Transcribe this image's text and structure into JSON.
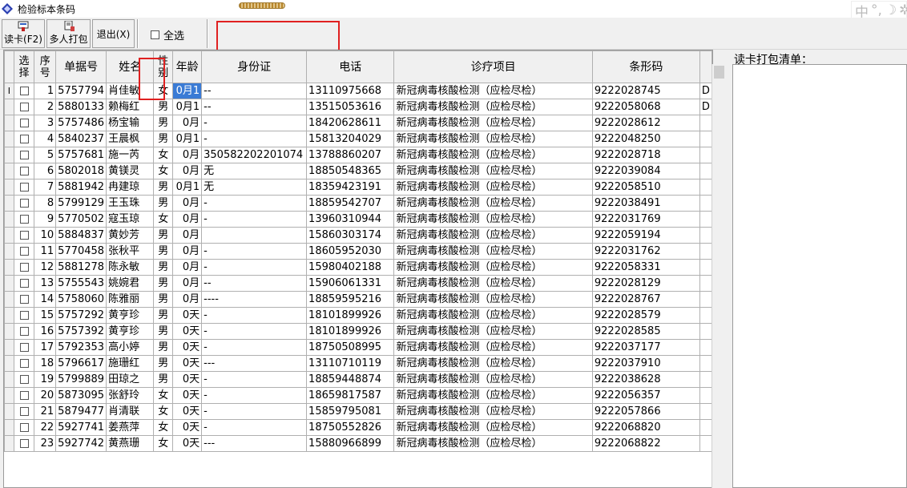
{
  "window": {
    "title": "检验标本条码"
  },
  "ime": {
    "label": "中"
  },
  "toolbar": {
    "read_card_label": "读卡(F2)",
    "multi_pack_label": "多人打包",
    "exit_label": "退出(X)",
    "select_all_label": "全选"
  },
  "table": {
    "headers": {
      "select": "选择",
      "seq": "序号",
      "doc_no": "单据号",
      "name": "姓名",
      "sex": "性别",
      "age": "年龄",
      "id_card": "身份证",
      "phone": "电话",
      "item": "诊疗项目",
      "barcode": "条形码"
    },
    "current_row_marker": "I",
    "rows": [
      {
        "seq": "1",
        "doc": "5757794",
        "name": "肖佳敏",
        "sex": "女",
        "age": "0月1",
        "id": "--",
        "phone": "13110975668",
        "item": "新冠病毒核酸检测（应检尽检）",
        "barcode": "9222028745",
        "extra": "D"
      },
      {
        "seq": "2",
        "doc": "5880133",
        "name": "赖梅红",
        "sex": "男",
        "age": "0月1",
        "id": "--",
        "phone": "13515053616",
        "item": "新冠病毒核酸检测（应检尽检）",
        "barcode": "9222058068",
        "extra": "D"
      },
      {
        "seq": "3",
        "doc": "5757486",
        "name": "杨宝输",
        "sex": "男",
        "age": "0月",
        "id": "-",
        "phone": "18420628611",
        "item": "新冠病毒核酸检测（应检尽检）",
        "barcode": "9222028612",
        "extra": ""
      },
      {
        "seq": "4",
        "doc": "5840237",
        "name": "王晨枫",
        "sex": "男",
        "age": "0月1",
        "id": "-",
        "phone": "15813204029",
        "item": "新冠病毒核酸检测（应检尽检）",
        "barcode": "9222048250",
        "extra": ""
      },
      {
        "seq": "5",
        "doc": "5757681",
        "name": "施一芮",
        "sex": "女",
        "age": "0月",
        "id": "350582202201074",
        "phone": "13788860207",
        "item": "新冠病毒核酸检测（应检尽检）",
        "barcode": "9222028718",
        "extra": ""
      },
      {
        "seq": "6",
        "doc": "5802018",
        "name": "黄镁灵",
        "sex": "女",
        "age": "0月",
        "id": "无",
        "phone": "18850548365",
        "item": "新冠病毒核酸检测（应检尽检）",
        "barcode": "9222039084",
        "extra": ""
      },
      {
        "seq": "7",
        "doc": "5881942",
        "name": "冉建琼",
        "sex": "男",
        "age": "0月1",
        "id": " 无",
        "phone": "18359423191",
        "item": "新冠病毒核酸检测（应检尽检）",
        "barcode": "9222058510",
        "extra": ""
      },
      {
        "seq": "8",
        "doc": "5799129",
        "name": "王玉珠",
        "sex": "男",
        "age": "0月",
        "id": "-",
        "phone": "18859542707",
        "item": "新冠病毒核酸检测（应检尽检）",
        "barcode": "9222038491",
        "extra": ""
      },
      {
        "seq": "9",
        "doc": "5770502",
        "name": "寇玉琼",
        "sex": "女",
        "age": "0月",
        "id": "-",
        "phone": "13960310944",
        "item": "新冠病毒核酸检测（应检尽检）",
        "barcode": "9222031769",
        "extra": ""
      },
      {
        "seq": "10",
        "doc": "5884837",
        "name": "黄妙芳",
        "sex": "男",
        "age": "0月",
        "id": "",
        "phone": "15860303174",
        "item": "新冠病毒核酸检测（应检尽检）",
        "barcode": "9222059194",
        "extra": ""
      },
      {
        "seq": "11",
        "doc": "5770458",
        "name": "张秋平",
        "sex": "男",
        "age": "0月",
        "id": "-",
        "phone": "18605952030",
        "item": "新冠病毒核酸检测（应检尽检）",
        "barcode": "9222031762",
        "extra": ""
      },
      {
        "seq": "12",
        "doc": "5881278",
        "name": "陈永敏",
        "sex": "男",
        "age": "0月",
        "id": "-",
        "phone": "15980402188",
        "item": "新冠病毒核酸检测（应检尽检）",
        "barcode": "9222058331",
        "extra": ""
      },
      {
        "seq": "13",
        "doc": "5755543",
        "name": "姚婉君",
        "sex": "男",
        "age": "0月",
        "id": "--",
        "phone": "15906061331",
        "item": "新冠病毒核酸检测（应检尽检）",
        "barcode": "9222028129",
        "extra": ""
      },
      {
        "seq": "14",
        "doc": "5758060",
        "name": "陈雅丽",
        "sex": "男",
        "age": "0月",
        "id": "----",
        "phone": "18859595216",
        "item": "新冠病毒核酸检测（应检尽检）",
        "barcode": "9222028767",
        "extra": ""
      },
      {
        "seq": "15",
        "doc": "5757292",
        "name": "黄亨珍",
        "sex": "男",
        "age": "0天",
        "id": "-",
        "phone": "18101899926",
        "item": "新冠病毒核酸检测（应检尽检）",
        "barcode": "9222028579",
        "extra": ""
      },
      {
        "seq": "16",
        "doc": "5757392",
        "name": "黄亨珍",
        "sex": "男",
        "age": "0天",
        "id": "-",
        "phone": "18101899926",
        "item": "新冠病毒核酸检测（应检尽检）",
        "barcode": "9222028585",
        "extra": ""
      },
      {
        "seq": "17",
        "doc": "5792353",
        "name": "高小婷",
        "sex": "男",
        "age": "0天",
        "id": "-",
        "phone": "18750508995",
        "item": "新冠病毒核酸检测（应检尽检）",
        "barcode": "9222037177",
        "extra": ""
      },
      {
        "seq": "18",
        "doc": "5796617",
        "name": "施珊红",
        "sex": "男",
        "age": "0天",
        "id": "---",
        "phone": "13110710119",
        "item": "新冠病毒核酸检测（应检尽检）",
        "barcode": "9222037910",
        "extra": ""
      },
      {
        "seq": "19",
        "doc": "5799889",
        "name": "田琼之",
        "sex": "男",
        "age": "0天",
        "id": "-",
        "phone": "18859448874",
        "item": "新冠病毒核酸检测（应检尽检）",
        "barcode": "9222038628",
        "extra": ""
      },
      {
        "seq": "20",
        "doc": "5873095",
        "name": "张舒玲",
        "sex": "女",
        "age": "0天",
        "id": "-",
        "phone": "18659817587",
        "item": "新冠病毒核酸检测（应检尽检）",
        "barcode": "9222056357",
        "extra": ""
      },
      {
        "seq": "21",
        "doc": "5879477",
        "name": "肖清联",
        "sex": "女",
        "age": "0天",
        "id": "-",
        "phone": "15859795081",
        "item": "新冠病毒核酸检测（应检尽检）",
        "barcode": "9222057866",
        "extra": ""
      },
      {
        "seq": "22",
        "doc": "5927741",
        "name": "姜燕萍",
        "sex": "女",
        "age": "0天",
        "id": "-",
        "phone": "18750552826",
        "item": "新冠病毒核酸检测（应检尽检）",
        "barcode": "9222068820",
        "extra": ""
      },
      {
        "seq": "23",
        "doc": "5927742",
        "name": "黄燕珊",
        "sex": "女",
        "age": "0天",
        "id": "---",
        "phone": "15880966899",
        "item": "新冠病毒核酸检测（应检尽检）",
        "barcode": "9222068822",
        "extra": ""
      }
    ]
  },
  "right_panel": {
    "label": "读卡打包清单："
  },
  "colors": {
    "selection": "#3a7bd5",
    "highlight_box": "#e02020"
  }
}
